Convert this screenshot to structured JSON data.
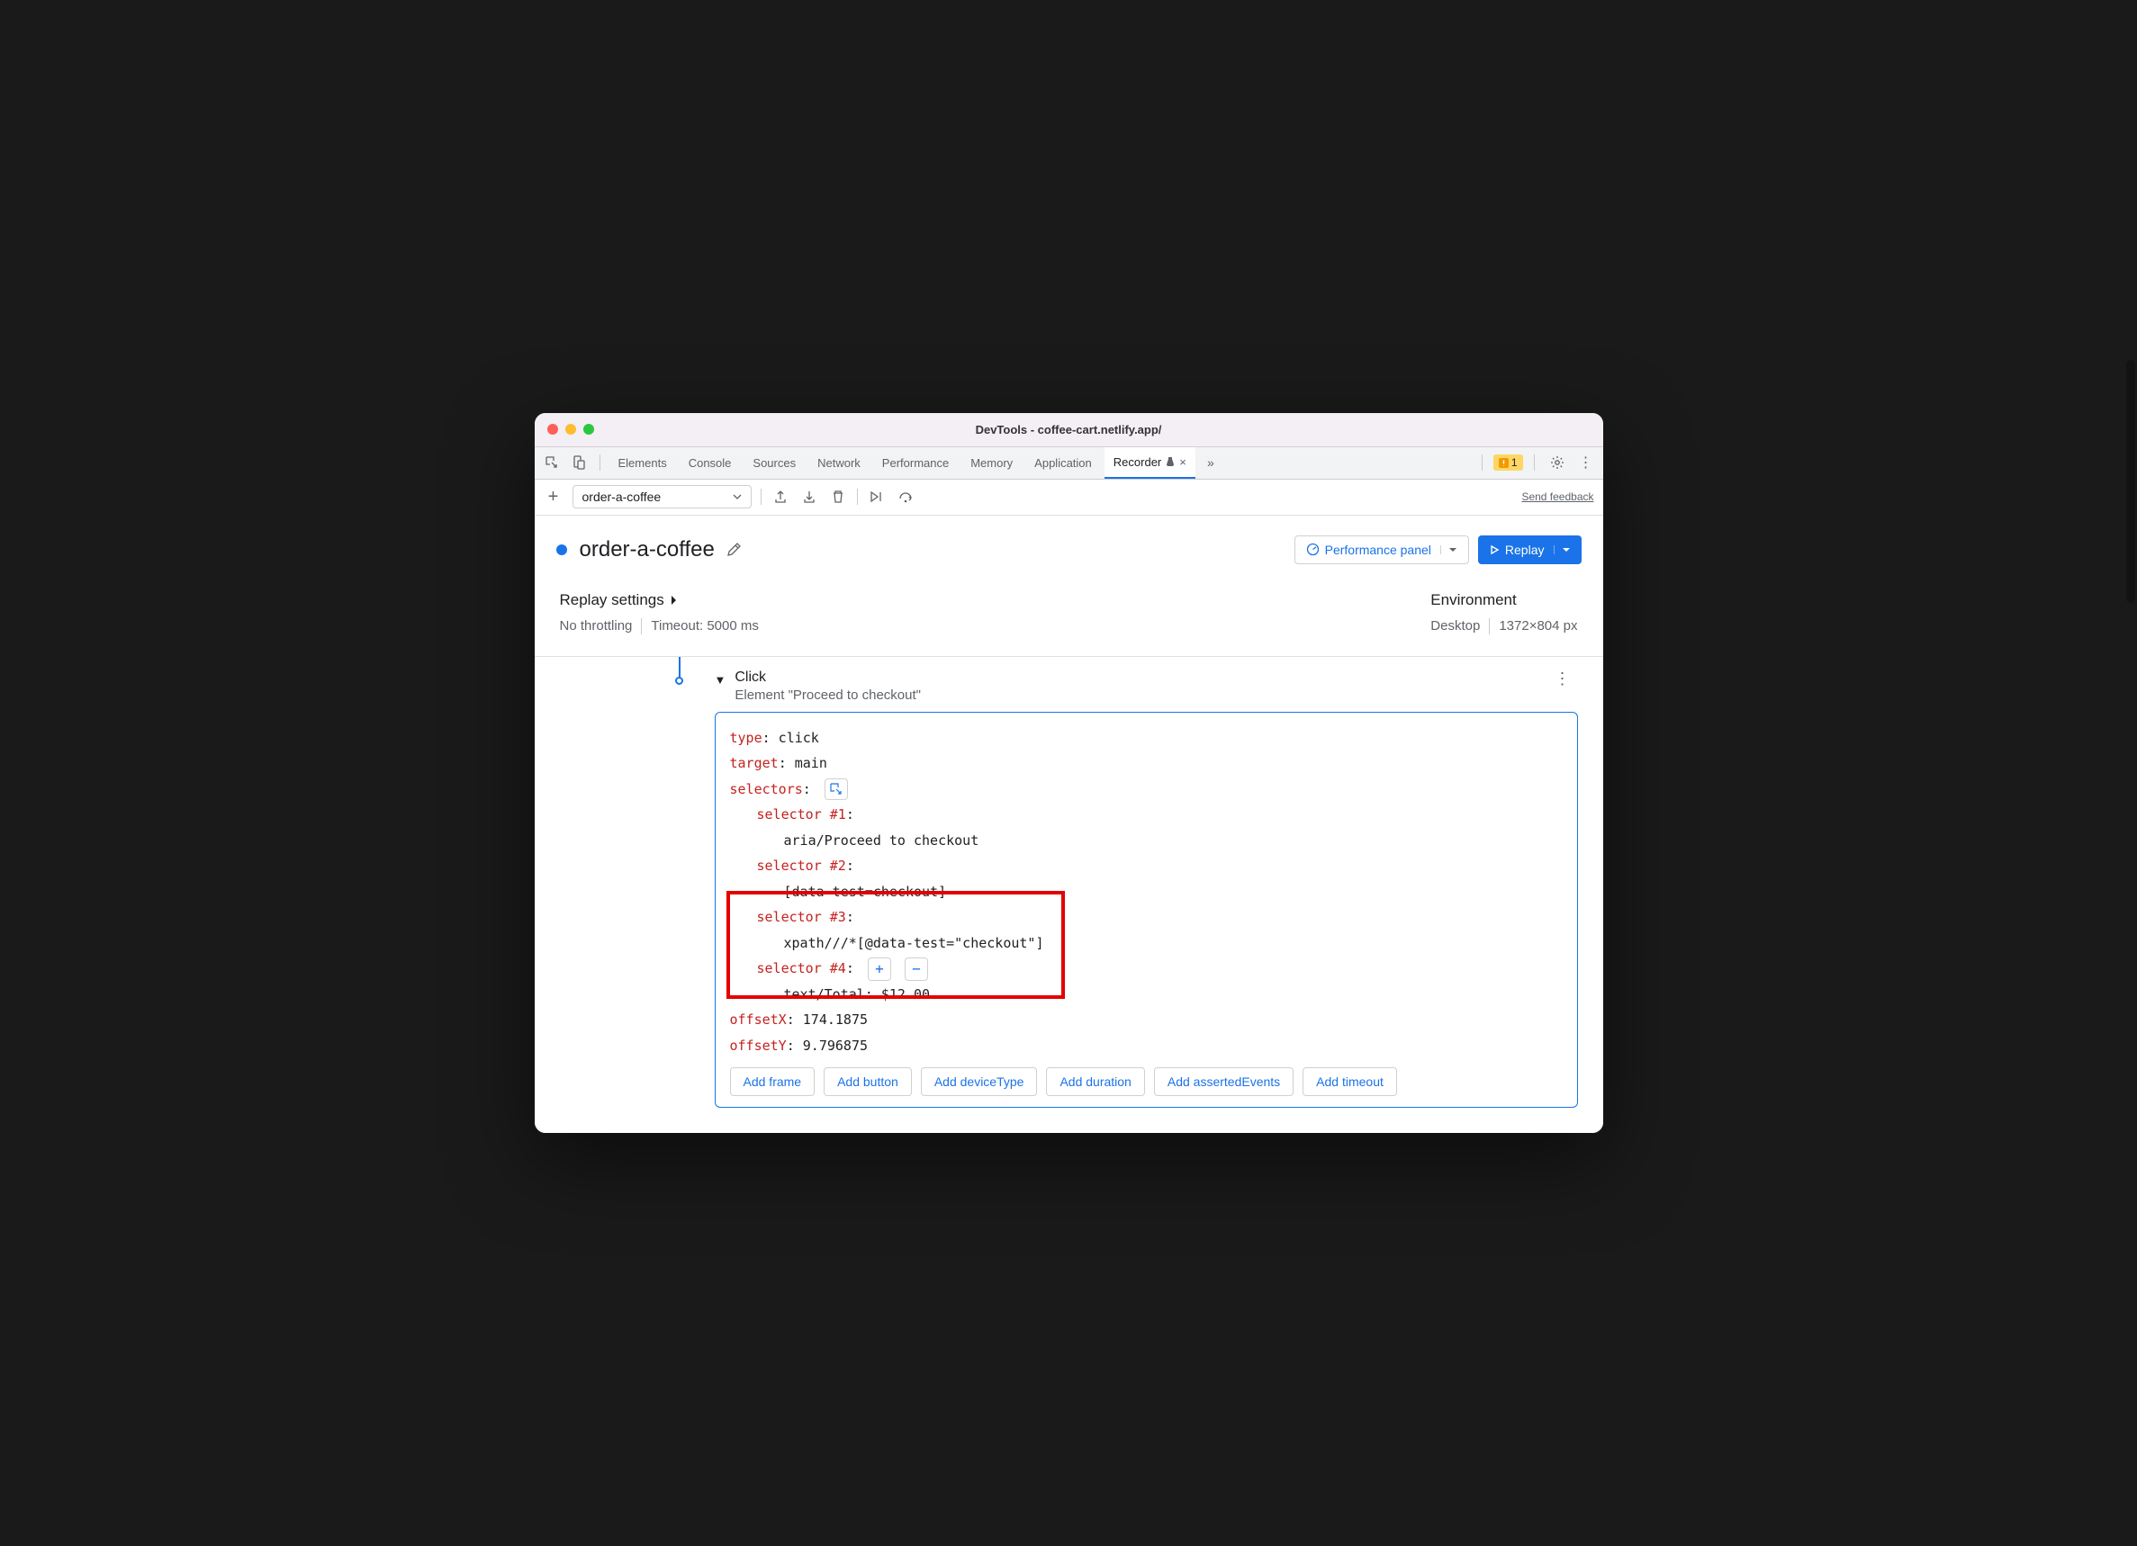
{
  "window": {
    "title": "DevTools - coffee-cart.netlify.app/"
  },
  "tabs": {
    "elements": "Elements",
    "console": "Console",
    "sources": "Sources",
    "network": "Network",
    "performance": "Performance",
    "memory": "Memory",
    "application": "Application",
    "recorder": "Recorder",
    "warnings": "1"
  },
  "toolbar": {
    "recording_name": "order-a-coffee",
    "feedback": "Send feedback"
  },
  "header": {
    "title": "order-a-coffee",
    "perf_button": "Performance panel",
    "replay_button": "Replay"
  },
  "settings": {
    "replay_title": "Replay settings",
    "throttling": "No throttling",
    "timeout": "Timeout: 5000 ms",
    "env_title": "Environment",
    "device": "Desktop",
    "dimensions": "1372×804 px"
  },
  "step": {
    "title": "Click",
    "subtitle": "Element \"Proceed to checkout\"",
    "code": {
      "type_key": "type",
      "type_val": ": click",
      "target_key": "target",
      "target_val": ": main",
      "selectors_key": "selectors",
      "selectors_val": ":",
      "sel1_key": "selector #1",
      "sel1_val": "aria/Proceed to checkout",
      "sel2_key": "selector #2",
      "sel2_val": "[data-test=checkout]",
      "sel3_key": "selector #3",
      "sel3_val": "xpath///*[@data-test=\"checkout\"]",
      "sel4_key": "selector #4",
      "sel4_val": "text/Total: $12.00",
      "offx_key": "offsetX",
      "offx_val": ": 174.1875",
      "offy_key": "offsetY",
      "offy_val": ": 9.796875"
    },
    "add_buttons": {
      "frame": "Add frame",
      "button": "Add button",
      "deviceType": "Add deviceType",
      "duration": "Add duration",
      "assertedEvents": "Add assertedEvents",
      "timeout": "Add timeout"
    }
  }
}
